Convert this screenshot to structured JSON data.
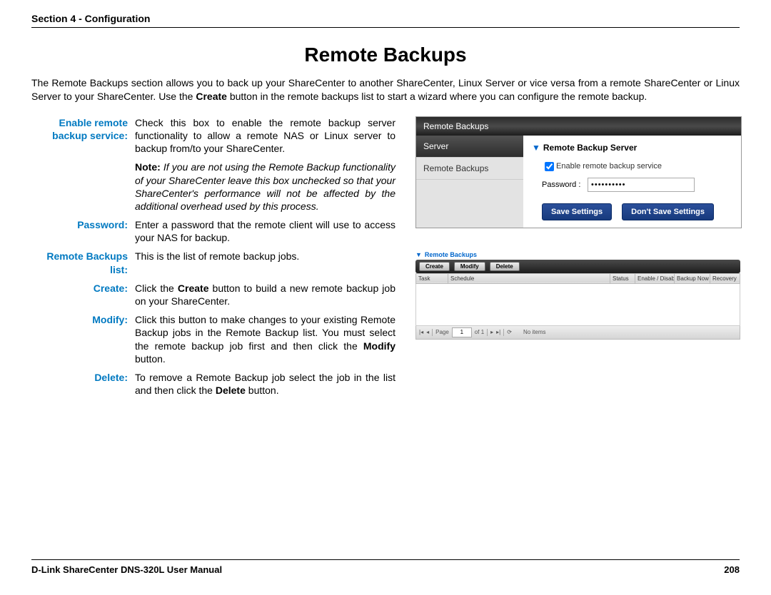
{
  "header": {
    "section": "Section 4 - Configuration"
  },
  "title": "Remote Backups",
  "intro_a": "The Remote Backups section allows you to back up your ShareCenter to another ShareCenter, Linux Server or vice versa from a remote ShareCenter or Linux Server to your ShareCenter. Use the ",
  "intro_bold": "Create",
  "intro_b": " button in the remote backups list to start a wizard where you can configure the remote backup.",
  "defs": {
    "enable_label": "Enable remote backup service:",
    "enable_text": "Check this box to enable the remote backup server functionality to allow a remote NAS or Linux server to backup from/to your ShareCenter.",
    "note_prefix": "Note:",
    "note_text": " If you are not using the Remote Backup functionality of your ShareCenter leave this box unchecked so that your ShareCenter's performance will not be affected by the additional overhead used by this process.",
    "password_label": "Password:",
    "password_text": "Enter a password that the remote client will use to access your NAS for backup.",
    "list_label": "Remote Backups list:",
    "list_text": "This is the list of remote backup jobs.",
    "create_label": "Create:",
    "create_a": "Click the ",
    "create_bold": "Create",
    "create_b": " button to build a new remote backup job on your ShareCenter.",
    "modify_label": "Modify:",
    "modify_a": "Click this button to make changes to your existing Remote Backup jobs in the Remote Backup list. You must select the remote backup job first and then click the ",
    "modify_bold": "Modify",
    "modify_b": " button.",
    "delete_label": "Delete:",
    "delete_a": "To remove a Remote Backup job select the job in the list and then click the ",
    "delete_bold": "Delete",
    "delete_b": " button."
  },
  "shot1": {
    "panel_title": "Remote Backups",
    "side_server": "Server",
    "side_remote": "Remote Backups",
    "accordion": "Remote Backup Server",
    "checkbox_label": "Enable remote backup service",
    "password_label": "Password :",
    "password_value": "••••••••••",
    "save_btn": "Save Settings",
    "dont_save_btn": "Don't Save Settings"
  },
  "shot2": {
    "title": "Remote Backups",
    "btn_create": "Create",
    "btn_modify": "Modify",
    "btn_delete": "Delete",
    "col_task": "Task",
    "col_schedule": "Schedule",
    "col_status": "Status",
    "col_toggle": "Enable / Disable",
    "col_backup": "Backup Now",
    "col_recovery": "Recovery",
    "pager_page": "Page",
    "pager_num": "1",
    "pager_of": "of 1",
    "pager_msg": "No items"
  },
  "footer": {
    "left": "D-Link ShareCenter DNS-320L User Manual",
    "right": "208"
  }
}
